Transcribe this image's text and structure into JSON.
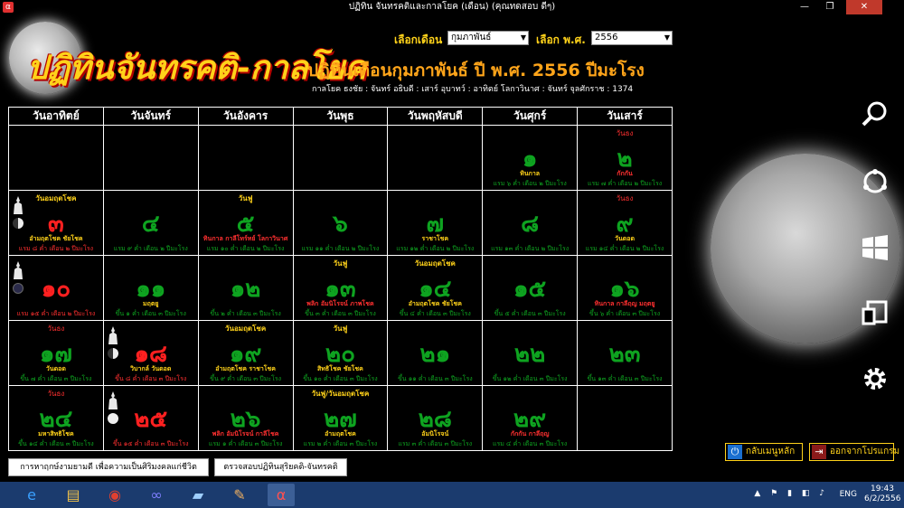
{
  "window": {
    "title": "ปฏิทิน จันทรคติและกาลโยค (เดือน) (คุณทดสอบ ดีๆ)",
    "minimize": "—",
    "maximize": "❐",
    "close": "✕"
  },
  "logo": {
    "text": "ปฏิทินจันทรคติ-กาลโยค"
  },
  "month_select": {
    "label": "เลือกเดือน",
    "value": "กุมภาพันธ์"
  },
  "year_select": {
    "label": "เลือก พ.ศ.",
    "value": "2556"
  },
  "heading": "ปฏิทินเดือนกุมภาพันธ์  ปี พ.ศ. 2556  ปีมะโรง",
  "subheading": "กาลโยค ธงชัย : จันทร์   อธิบดี : เสาร์   อุบาทว์ : อาทิตย์   โลกาวินาศ : จันทร์   จุลศักราช : 1374",
  "weekdays": [
    "วันอาทิตย์",
    "วันจันทร์",
    "วันอังคาร",
    "วันพุธ",
    "วันพฤหัสบดี",
    "วันศุกร์",
    "วันเสาร์"
  ],
  "cells": [
    {},
    {},
    {},
    {},
    {},
    {
      "top": "",
      "num": "๑",
      "note": "ทินกาล",
      "bot": "แรม ๖ ค่ำ เดือน ๒ ปีมะโรง"
    },
    {
      "top": "วันธง",
      "num": "๒",
      "note": "กักกัน",
      "bot": "แรม ๗ ค่ำ เดือน ๒ ปีมะโรง",
      "top_red": true,
      "note_red": true
    },
    {
      "top": "วันอมฤตโชค",
      "num": "๓",
      "note": "อำมฤตโชค ชัยโชค",
      "bot": "แรม ๘ ค่ำ เดือน ๒ ปีมะโรง",
      "red": true,
      "moon": "half",
      "buddha": true
    },
    {
      "top": "",
      "num": "๔",
      "note": "",
      "bot": "แรม ๙ ค่ำ เดือน ๒ ปีมะโรง"
    },
    {
      "top": "วันฟู",
      "num": "๕",
      "note": "ทินกาล กาลีโทร์ทย์ โลกาวินาศ",
      "bot": "แรม ๑๐ ค่ำ เดือน ๒ ปีมะโรง",
      "note_red": true
    },
    {
      "top": "",
      "num": "๖",
      "note": "",
      "bot": "แรม ๑๑ ค่ำ เดือน ๒ ปีมะโรง"
    },
    {
      "top": "",
      "num": "๗",
      "note": "ราชาโชค",
      "bot": "แรม ๑๒ ค่ำ เดือน ๒ ปีมะโรง"
    },
    {
      "top": "",
      "num": "๘",
      "note": "",
      "bot": "แรม ๑๓ ค่ำ เดือน ๒ ปีมะโรง"
    },
    {
      "top": "วันธง",
      "num": "๙",
      "note": "วันดอด",
      "bot": "แรม ๑๔ ค่ำ เดือน ๒ ปีมะโรง",
      "top_red": true
    },
    {
      "top": "",
      "num": "๑๐",
      "note": "",
      "bot": "แรม ๑๕ ค่ำ เดือน ๒ ปีมะโรง",
      "red": true,
      "moon": "new",
      "buddha": true
    },
    {
      "top": "",
      "num": "๑๑",
      "note": "มฤตยู",
      "bot": "ขึ้น ๑ ค่ำ เดือน ๓ ปีมะโรง"
    },
    {
      "top": "",
      "num": "๑๒",
      "note": "",
      "bot": "ขึ้น ๒ ค่ำ เดือน ๓ ปีมะโรง"
    },
    {
      "top": "วันฟู",
      "num": "๑๓",
      "note": "พลิก อัมนิโรจน์ ภาพโชค",
      "bot": "ขึ้น ๓ ค่ำ เดือน ๓ ปีมะโรง",
      "note_red": true
    },
    {
      "top": "วันอมฤตโชค",
      "num": "๑๔",
      "note": "อำมฤตโชค ชัยโชค",
      "bot": "ขึ้น ๔ ค่ำ เดือน ๓ ปีมะโรง"
    },
    {
      "top": "",
      "num": "๑๕",
      "note": "",
      "bot": "ขึ้น ๕ ค่ำ เดือน ๓ ปีมะโรง"
    },
    {
      "top": "",
      "num": "๑๖",
      "note": "ทินกาล กาลีฤญ มฤตยู",
      "bot": "ขึ้น ๖ ค่ำ เดือน ๓ ปีมะโรง",
      "note_red": true
    },
    {
      "top": "วันธง",
      "num": "๑๗",
      "note": "วันดอด",
      "bot": "ขึ้น ๗ ค่ำ เดือน ๓ ปีมะโรง",
      "top_red": true
    },
    {
      "top": "",
      "num": "๑๘",
      "note": "วิบากล์ วันดอด",
      "bot": "ขึ้น ๘ ค่ำ เดือน ๓ ปีมะโรง",
      "red": true,
      "moon": "half",
      "buddha": true
    },
    {
      "top": "วันอมฤตโชค",
      "num": "๑๙",
      "note": "อำมฤตโชค ราชาโชค",
      "bot": "ขึ้น ๙ ค่ำ เดือน ๓ ปีมะโรง"
    },
    {
      "top": "วันฟู",
      "num": "๒๐",
      "note": "สิทธิโชค ชัยโชค",
      "bot": "ขึ้น ๑๐ ค่ำ เดือน ๓ ปีมะโรง"
    },
    {
      "top": "",
      "num": "๒๑",
      "note": "",
      "bot": "ขึ้น ๑๑ ค่ำ เดือน ๓ ปีมะโรง"
    },
    {
      "top": "",
      "num": "๒๒",
      "note": "",
      "bot": "ขึ้น ๑๒ ค่ำ เดือน ๓ ปีมะโรง"
    },
    {
      "top": "",
      "num": "๒๓",
      "note": "",
      "bot": "ขึ้น ๑๓ ค่ำ เดือน ๓ ปีมะโรง"
    },
    {
      "top": "วันธง",
      "num": "๒๔",
      "note": "มหาสิทธิโชค",
      "bot": "ขึ้น ๑๔ ค่ำ เดือน ๓ ปีมะโรง",
      "top_red": true
    },
    {
      "top": "",
      "num": "๒๕",
      "note": "",
      "bot": "ขึ้น ๑๕ ค่ำ เดือน ๓ ปีมะโรง",
      "red": true,
      "moon": "full",
      "buddha": true
    },
    {
      "top": "",
      "num": "๒๖",
      "note": "พลิก อัมนิโรจน์ กาลีโชค",
      "bot": "แรม ๑ ค่ำ เดือน ๓ ปีมะโรง",
      "note_red": true
    },
    {
      "top": "วันฟู/วันอมฤตโชค",
      "num": "๒๗",
      "note": "อำมฤตโชค",
      "bot": "แรม ๒ ค่ำ เดือน ๓ ปีมะโรง"
    },
    {
      "top": "",
      "num": "๒๘",
      "note": "อัมนิโรจน์",
      "bot": "แรม ๓ ค่ำ เดือน ๓ ปีมะโรง"
    },
    {
      "top": "",
      "num": "๒๙",
      "note": "กักกัน กาลีฤญ",
      "bot": "แรม ๔ ค่ำ เดือน ๓ ปีมะโรง",
      "note_red": true
    },
    {}
  ],
  "buttons": {
    "find_auspicious": "การหาฤกษ์งามยามดี เพื่อความเป็นศิริมงคลแก่ชีวิต",
    "check_calendar": "ตรวจสอบปฏิทินสุริยคติ-จันทรคติ",
    "back_menu": "กลับเมนูหลัก",
    "exit": "ออกจากโปรแกรม"
  },
  "charms": [
    "search-icon",
    "share-icon",
    "start-icon",
    "devices-icon",
    "settings-icon"
  ],
  "taskbar": {
    "apps": [
      "ie-icon",
      "explorer-icon",
      "chrome-icon",
      "app-infinity-icon",
      "app-book-icon",
      "paint-icon",
      "calendar-app-icon"
    ],
    "lang": "ENG",
    "time": "19:43",
    "date": "6/2/2556"
  }
}
